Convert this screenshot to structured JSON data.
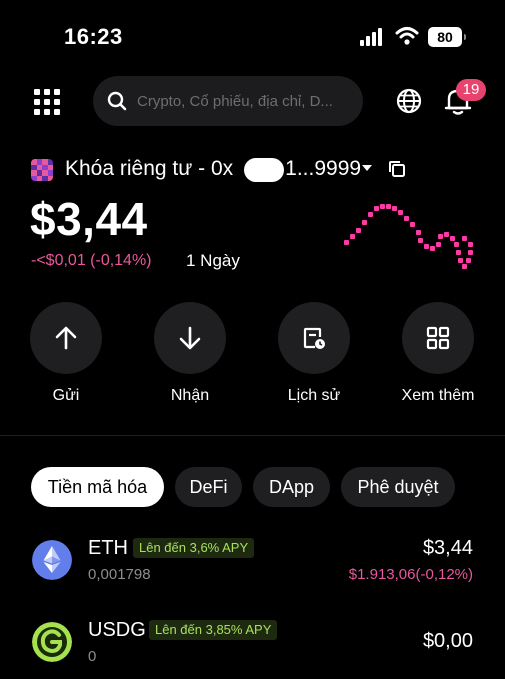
{
  "status_bar": {
    "time": "16:23",
    "battery": "80"
  },
  "search": {
    "placeholder": "Crypto, Cổ phiếu, địa chỉ, D..."
  },
  "notifications": {
    "count": "19"
  },
  "account": {
    "name": "Khóa riêng tư - 0x",
    "name_suffix": "1...9999",
    "balance": "$3,44",
    "change": "-<$0,01 (-0,14%)",
    "period": "1 Ngày"
  },
  "actions": [
    {
      "label": "Gửi",
      "icon": "arrow-up-icon"
    },
    {
      "label": "Nhận",
      "icon": "arrow-down-icon"
    },
    {
      "label": "Lịch sử",
      "icon": "history-icon"
    },
    {
      "label": "Xem thêm",
      "icon": "more-grid-icon"
    }
  ],
  "tabs": [
    {
      "label": "Tiền mã hóa",
      "active": true
    },
    {
      "label": "DeFi",
      "active": false
    },
    {
      "label": "DApp",
      "active": false
    },
    {
      "label": "Phê duyệt",
      "active": false
    }
  ],
  "tokens": [
    {
      "symbol": "ETH",
      "apy": "Lên đến 3,6% APY",
      "amount": "0,001798",
      "value": "$3,44",
      "change": "$1.913,06(-0,12%)",
      "icon": "ethereum-icon"
    },
    {
      "symbol": "USDG",
      "apy": "Lên đến 3,85% APY",
      "amount": "0",
      "value": "$0,00",
      "change": "",
      "icon": "usdg-icon"
    }
  ],
  "colors": {
    "accent_pink": "#e8589c",
    "apy_green": "#a8e05a",
    "badge_red": "#e8436e",
    "eth_blue": "#627eea"
  }
}
